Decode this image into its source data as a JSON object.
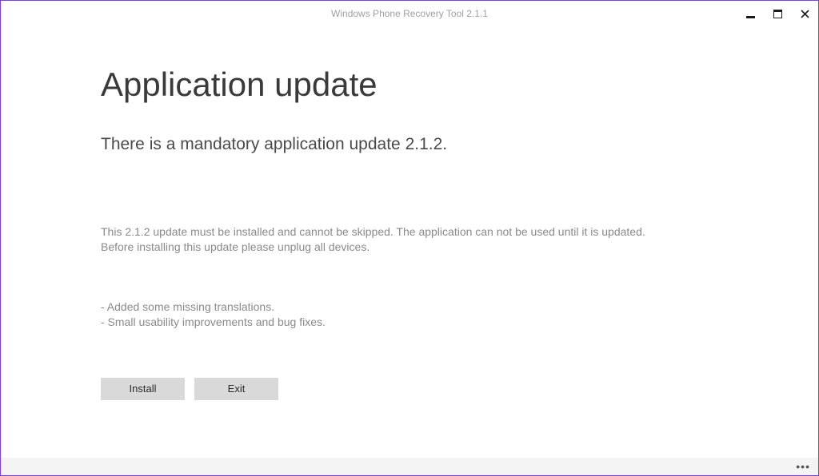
{
  "window": {
    "title": "Windows Phone Recovery Tool 2.1.1"
  },
  "main": {
    "heading": "Application update",
    "subheading": "There is a mandatory application update 2.1.2.",
    "body_line1": "This 2.1.2 update must be installed and cannot be skipped. The application can not be used until it is updated.",
    "body_line2": "Before installing this update please unplug all devices.",
    "changelog_line1": "- Added some missing translations.",
    "changelog_line2": "- Small usability improvements and bug fixes."
  },
  "buttons": {
    "install": "Install",
    "exit": "Exit"
  }
}
